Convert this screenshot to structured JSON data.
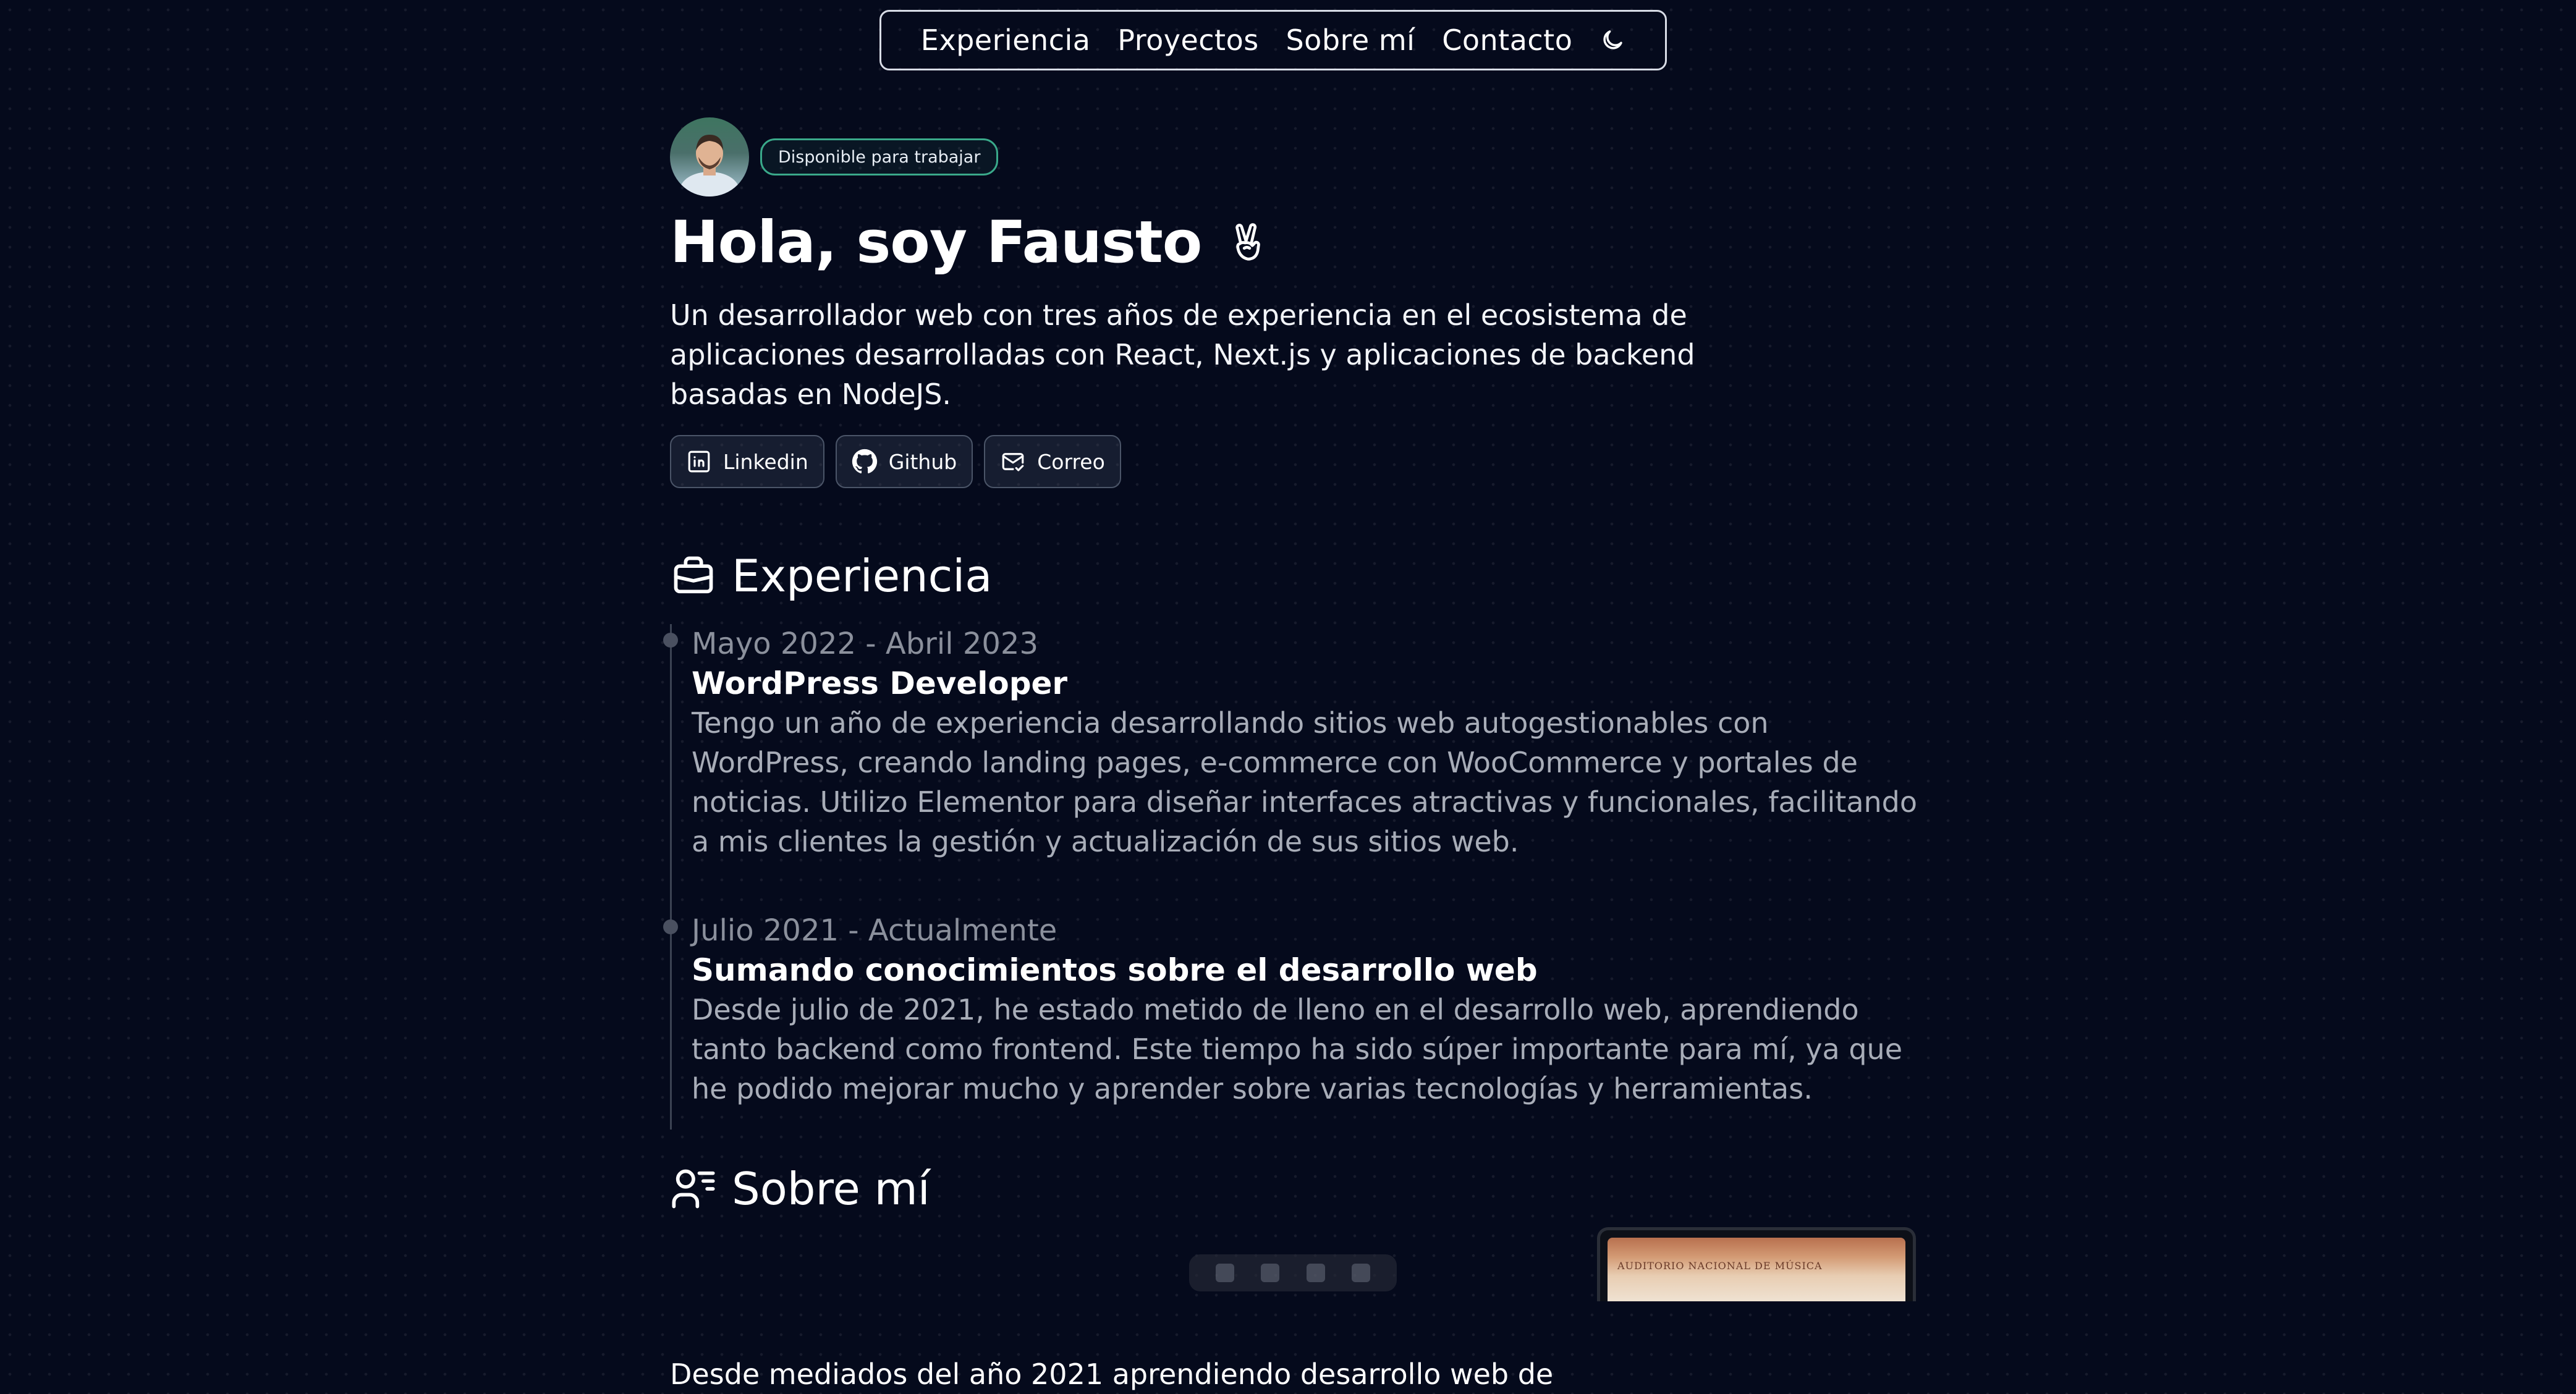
{
  "nav": {
    "items": [
      {
        "label": "Experiencia"
      },
      {
        "label": "Proyectos"
      },
      {
        "label": "Sobre mí"
      },
      {
        "label": "Contacto"
      }
    ],
    "theme_icon": "moon-icon"
  },
  "hero": {
    "badge": "Disponible para trabajar",
    "title": "Hola, soy Fausto",
    "title_icon": "victory-hand-icon",
    "description": "Un desarrollador web con tres años de experiencia en el ecosistema de aplicaciones desarrolladas con React, Next.js y aplicaciones de backend basadas en NodeJS.",
    "socials": [
      {
        "label": "Linkedin",
        "icon": "linkedin-icon"
      },
      {
        "label": "Github",
        "icon": "github-icon"
      },
      {
        "label": "Correo",
        "icon": "mail-icon"
      }
    ]
  },
  "experience": {
    "title": "Experiencia",
    "icon": "briefcase-icon",
    "items": [
      {
        "date": "Mayo 2022 - Abril 2023",
        "role": "WordPress Developer",
        "description": "Tengo un año de experiencia desarrollando sitios web autogestionables con WordPress, creando landing pages, e-commerce con WooCommerce y portales de noticias. Utilizo Elementor para diseñar interfaces atractivas y funcionales, facilitando a mis clientes la gestión y actualización de sus sitios web."
      },
      {
        "date": "Julio 2021 - Actualmente",
        "role": "Sumando conocimientos sobre el desarrollo web",
        "description": "Desde julio de 2021, he estado metido de lleno en el desarrollo web, aprendiendo tanto backend como frontend. Este tiempo ha sido súper importante para mí, ya que he podido mejorar mucho y aprender sobre varias tecnologías y herramientas."
      }
    ]
  },
  "about": {
    "title": "Sobre mí",
    "icon": "user-list-icon",
    "text": "Desde mediados del año 2021 aprendiendo desarrollo web de",
    "photo_caption": "AUDITORIO NACIONAL DE MÚSICA"
  },
  "colors": {
    "background": "#050a1c",
    "badge_border": "#3aa98a",
    "muted_text": "#a8adb8"
  }
}
